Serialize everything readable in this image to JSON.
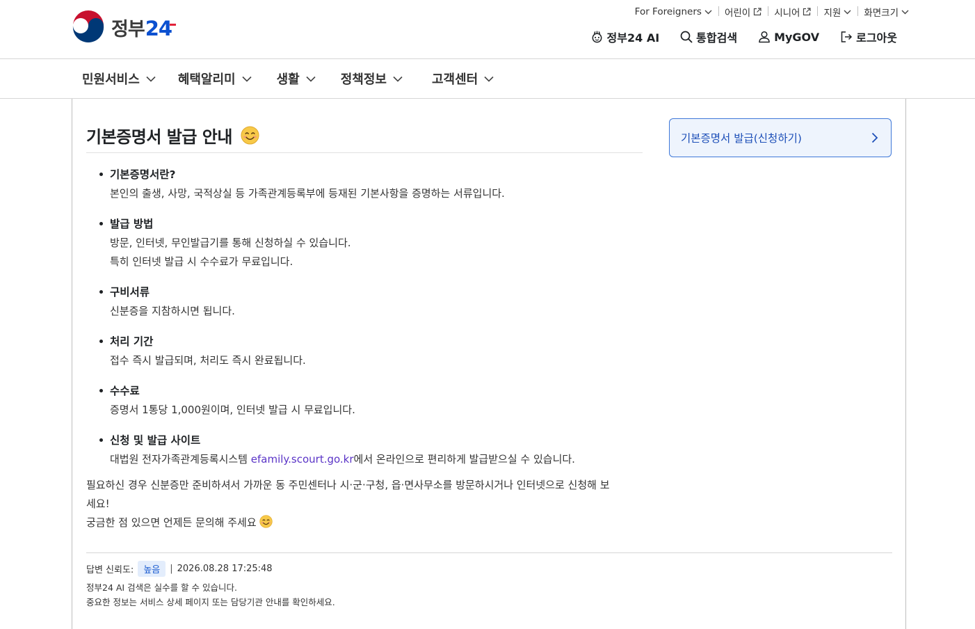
{
  "header": {
    "logo_text": "정부",
    "logo_num": "2",
    "logo_num2": "4",
    "util": [
      {
        "label": "For Foreigners",
        "icon": "chevron-down-icon"
      },
      {
        "label": "어린이",
        "icon": "external-link-icon"
      },
      {
        "label": "시니어",
        "icon": "external-link-icon"
      },
      {
        "label": "지원",
        "icon": "chevron-down-icon"
      },
      {
        "label": "화면크기",
        "icon": "chevron-down-icon"
      }
    ],
    "gnb": [
      {
        "label": "정부24 AI",
        "icon": "ai-icon"
      },
      {
        "label": "통합검색",
        "icon": "search-icon"
      },
      {
        "label": "MyGOV",
        "icon": "user-icon"
      },
      {
        "label": "로그아웃",
        "icon": "logout-icon"
      }
    ]
  },
  "nav": [
    {
      "label": "민원서비스"
    },
    {
      "label": "혜택알리미"
    },
    {
      "label": "생활"
    },
    {
      "label": "정책정보"
    },
    {
      "label": "고객센터"
    }
  ],
  "answer": {
    "title": "기본증명서 발급 안내",
    "title_emoji": "smiling-face-icon",
    "items": [
      {
        "head": "기본증명서란?",
        "lines": [
          "본인의 출생, 사망, 국적상실 등 가족관계등록부에 등재된 기본사항을 증명하는 서류입니다."
        ]
      },
      {
        "head": "발급 방법",
        "lines": [
          "방문, 인터넷, 무인발급기를 통해 신청하실 수 있습니다.",
          "특히 인터넷 발급 시 수수료가 무료입니다."
        ]
      },
      {
        "head": "구비서류",
        "lines": [
          "신분증을 지참하시면 됩니다."
        ]
      },
      {
        "head": "처리 기간",
        "lines": [
          "접수 즉시 발급되며, 처리도 즉시 완료됩니다."
        ]
      },
      {
        "head": "수수료",
        "lines": [
          "증명서 1통당 1,000원이며, 인터넷 발급 시 무료입니다."
        ]
      }
    ],
    "site_item": {
      "head": "신청 및 발급 사이트",
      "before": "대법원 전자가족관계등록시스템 ",
      "link": "efamily.scourt.go.kr",
      "after": "에서 온라인으로 편리하게 발급받으실 수 있습니다."
    },
    "closing_line1": "필요하신 경우 신분증만 준비하셔서 가까운 동 주민센터나 시·군·구청, 읍·면사무소를 방문하시거나 인터넷으로 신청해 보",
    "closing_line2": "세요!",
    "closing_line3": "궁금한 점 있으면 언제든 문의해 주세요"
  },
  "side_button": {
    "label": "기본증명서 발급(신청하기)",
    "icon": "chevron-right-icon"
  },
  "meta": {
    "reliability_label": "답변 신뢰도:",
    "reliability_value": "높음",
    "separator": "|",
    "timestamp": "2026.08.28 17:25:48",
    "notice_line1": "정부24 AI 검색은 실수를 할 수 있습니다.",
    "notice_line2": "중요한 정보는 서비스 상세 페이지 또는 담당기관 안내를 확인하세요."
  },
  "colors": {
    "brand_blue": "#0b50d0",
    "accent_red": "#e2233a",
    "button_border": "#3e78d8",
    "button_bg": "#eef4fd",
    "link_purple": "#5a34c7",
    "badge_bg": "#e3edfc"
  }
}
